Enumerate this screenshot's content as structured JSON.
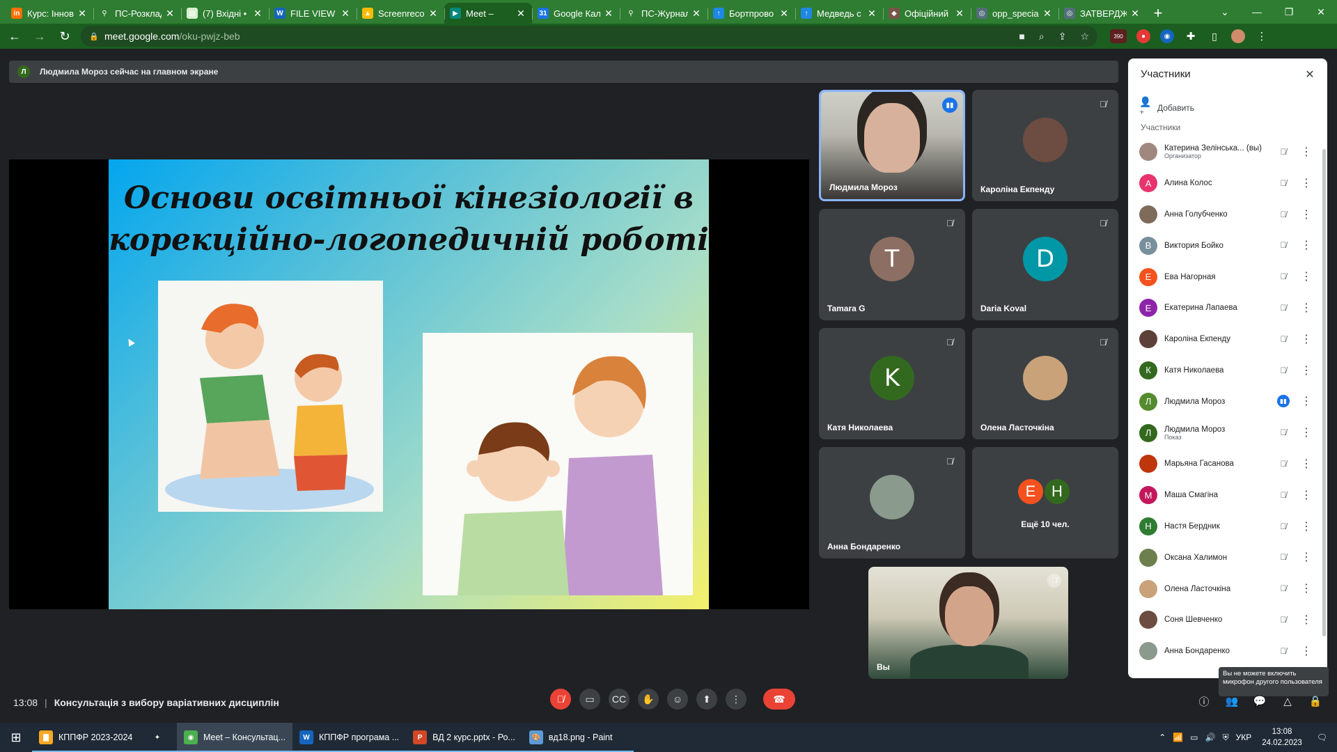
{
  "browser": {
    "tabs": [
      {
        "title": "Курс: Іннов",
        "fav_color": "#ff6f00",
        "fav_glyph": "in"
      },
      {
        "title": "ПС-Розклад",
        "fav_color": "#2e7d32",
        "fav_glyph": "⚲"
      },
      {
        "title": "(7) Вхідні •",
        "fav_color": "#d7f0d0",
        "fav_glyph": "▤"
      },
      {
        "title": "FILE VIEW",
        "fav_color": "#1565c0",
        "fav_glyph": "W"
      },
      {
        "title": "Screenreco",
        "fav_color": "#fbbc04",
        "fav_glyph": "▲"
      },
      {
        "title": "Meet –",
        "fav_color": "#00897b",
        "fav_glyph": "▶",
        "active": true
      },
      {
        "title": "Google Кал",
        "fav_color": "#1a73e8",
        "fav_glyph": "31"
      },
      {
        "title": "ПС-Журнал",
        "fav_color": "#2e7d32",
        "fav_glyph": "⚲"
      },
      {
        "title": "Бортпрово",
        "fav_color": "#1e88e5",
        "fav_glyph": "↑"
      },
      {
        "title": "Медведь с",
        "fav_color": "#1e88e5",
        "fav_glyph": "↑"
      },
      {
        "title": "Офіційний",
        "fav_color": "#795548",
        "fav_glyph": "◆"
      },
      {
        "title": "opp_specia",
        "fav_color": "#546e7a",
        "fav_glyph": "◎"
      },
      {
        "title": "ЗАТВЕРДЖ",
        "fav_color": "#546e7a",
        "fav_glyph": "◎"
      }
    ],
    "url_host": "meet.google.com",
    "url_path": "/oku-pwjz-beb",
    "ext_badge": "390"
  },
  "meet": {
    "banner_initial": "Л",
    "banner_text": "Людмила Мороз сейчас на главном экране",
    "slide_title_line1": "Основи освітньої кінезіології в",
    "slide_title_line2": "корекційно-логопедичній роботі",
    "tiles": [
      {
        "name": "Людмила Мороз",
        "kind": "camera",
        "speaking": true
      },
      {
        "name": "Кароліна Екпенду",
        "kind": "photo",
        "color": "#6d4c41"
      },
      {
        "name": "Tamara G",
        "kind": "initial",
        "initial": "T",
        "color": "#8d6e63"
      },
      {
        "name": "Daria Koval",
        "kind": "initial",
        "initial": "D",
        "color": "#0097a7"
      },
      {
        "name": "Катя Николаева",
        "kind": "initial",
        "initial": "K",
        "color": "#33691e"
      },
      {
        "name": "Олена Ласточкіна",
        "kind": "photo",
        "color": "#c9a27a"
      },
      {
        "name": "Анна Бондаренко",
        "kind": "photo",
        "color": "#8a9a8c"
      }
    ],
    "more_tile": {
      "label": "Ещё 10 чел.",
      "avatars": [
        {
          "initial": "E",
          "color": "#f4511e"
        },
        {
          "initial": "H",
          "color": "#33691e"
        }
      ]
    },
    "self_tile_name": "Вы",
    "meeting_time": "13:08",
    "meeting_name": "Консультація з вибору варіативних дисциплін"
  },
  "panel": {
    "title": "Участники",
    "add_label": "Добавить",
    "section_label": "Участники",
    "participants": [
      {
        "name": "Катерина Зелінська... (вы)",
        "sub": "Организатор",
        "color": "#a1887f",
        "initial": "К",
        "photo": true
      },
      {
        "name": "Алина Колос",
        "sub": "",
        "color": "#e8336d",
        "initial": "A"
      },
      {
        "name": "Анна Голубченко",
        "sub": "",
        "color": "#7e6b5a",
        "initial": "А",
        "photo": true
      },
      {
        "name": "Виктория Бойко",
        "sub": "",
        "color": "#78909c",
        "initial": "В"
      },
      {
        "name": "Ева Нагорная",
        "sub": "",
        "color": "#f4511e",
        "initial": "Е"
      },
      {
        "name": "Екатерина Лапаева",
        "sub": "",
        "color": "#8e24aa",
        "initial": "Е"
      },
      {
        "name": "Кароліна Екпенду",
        "sub": "",
        "color": "#5d4037",
        "initial": "К",
        "photo": true
      },
      {
        "name": "Катя Николаева",
        "sub": "",
        "color": "#33691e",
        "initial": "К"
      },
      {
        "name": "Людмила Мороз",
        "sub": "",
        "color": "#558b2f",
        "initial": "Л",
        "speaking": true
      },
      {
        "name": "Людмила Мороз",
        "sub": "Показ",
        "color": "#33691e",
        "initial": "Л",
        "presenting": true
      },
      {
        "name": "Марьяна Гасанова",
        "sub": "",
        "color": "#bf360c",
        "initial": "М",
        "photo": true
      },
      {
        "name": "Маша Смагіна",
        "sub": "",
        "color": "#c2185b",
        "initial": "М"
      },
      {
        "name": "Настя Бердник",
        "sub": "",
        "color": "#2e7d32",
        "initial": "Н"
      },
      {
        "name": "Оксана Халимон",
        "sub": "",
        "color": "#6d7f4d",
        "initial": "О",
        "photo": true
      },
      {
        "name": "Олена Ласточкіна",
        "sub": "",
        "color": "#c9a27a",
        "initial": "О",
        "photo": true
      },
      {
        "name": "Соня Шевченко",
        "sub": "",
        "color": "#6d4c41",
        "initial": "С",
        "photo": true
      },
      {
        "name": "Анна Бондаренко",
        "sub": "",
        "color": "#8a9a8c",
        "initial": "А",
        "photo": true
      }
    ],
    "tooltip": "Вы не можете включить микрофон другого пользователя"
  },
  "taskbar": {
    "items": [
      {
        "label": "КППФР 2023-2024",
        "icon_color": "#f9a825",
        "glyph": "▇"
      },
      {
        "label": "",
        "icon_color": "#1f2a36",
        "glyph": "✦"
      },
      {
        "label": "Meet – Консультац...",
        "icon_color": "#4caf50",
        "glyph": "◉",
        "active": true
      },
      {
        "label": "КППФР програма ...",
        "icon_color": "#1565c0",
        "glyph": "W"
      },
      {
        "label": "ВД 2 курс.pptx - Ро...",
        "icon_color": "#d24726",
        "glyph": "P"
      },
      {
        "label": "вд18.png - Paint",
        "icon_color": "#5c9bd5",
        "glyph": "🎨"
      }
    ],
    "lang": "УКР",
    "time": "13:08",
    "date": "24.02.2023"
  }
}
